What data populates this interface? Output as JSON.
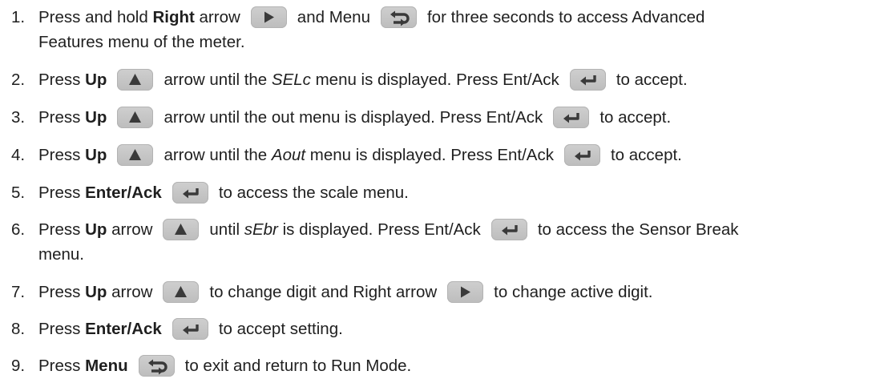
{
  "steps": [
    {
      "n": "1.",
      "parts": [
        [
          "Press and hold "
        ],
        [
          "Right",
          "b"
        ],
        [
          " arrow"
        ],
        [
          "K",
          "right"
        ],
        [
          "and Menu"
        ],
        [
          "K",
          "menu"
        ],
        [
          "for three seconds to access Advanced"
        ]
      ],
      "wrap": "Features menu of the meter."
    },
    {
      "n": "2.",
      "parts": [
        [
          "Press "
        ],
        [
          "Up",
          "b"
        ],
        [
          "K",
          "up"
        ],
        [
          "arrow until the "
        ],
        [
          "SELc",
          "i"
        ],
        [
          " menu is displayed. Press Ent/Ack"
        ],
        [
          "K",
          "enter"
        ],
        [
          "to accept."
        ]
      ]
    },
    {
      "n": "3.",
      "parts": [
        [
          "Press "
        ],
        [
          "Up",
          "b"
        ],
        [
          "K",
          "up"
        ],
        [
          "arrow until the out menu is displayed. Press Ent/Ack"
        ],
        [
          "K",
          "enter"
        ],
        [
          "to accept."
        ]
      ]
    },
    {
      "n": "4.",
      "parts": [
        [
          "Press "
        ],
        [
          "Up",
          "b"
        ],
        [
          "K",
          "up"
        ],
        [
          "arrow until the "
        ],
        [
          "Aout",
          "i"
        ],
        [
          " menu is displayed. Press Ent/Ack"
        ],
        [
          "K",
          "enter"
        ],
        [
          "to accept."
        ]
      ]
    },
    {
      "n": "5.",
      "parts": [
        [
          "Press "
        ],
        [
          "Enter/Ack",
          "b"
        ],
        [
          "K",
          "enter"
        ],
        [
          "to access the scale menu."
        ]
      ]
    },
    {
      "n": "6.",
      "parts": [
        [
          "Press "
        ],
        [
          "Up",
          "b"
        ],
        [
          " arrow"
        ],
        [
          "K",
          "up"
        ],
        [
          "until "
        ],
        [
          "sEbr",
          "i"
        ],
        [
          " is displayed. Press Ent/Ack"
        ],
        [
          "K",
          "enter"
        ],
        [
          "to access the Sensor Break"
        ]
      ],
      "wrap": "menu."
    },
    {
      "n": "7.",
      "parts": [
        [
          "Press "
        ],
        [
          "Up",
          "b"
        ],
        [
          " arrow"
        ],
        [
          "K",
          "up"
        ],
        [
          "to change digit and Right arrow"
        ],
        [
          "K",
          "right"
        ],
        [
          "to change active digit."
        ]
      ]
    },
    {
      "n": "8.",
      "parts": [
        [
          "Press "
        ],
        [
          "Enter/Ack",
          "b"
        ],
        [
          "K",
          "enter"
        ],
        [
          "to accept setting."
        ]
      ]
    },
    {
      "n": "9.",
      "parts": [
        [
          "Press "
        ],
        [
          "Menu",
          "b"
        ],
        [
          "K",
          "menu"
        ],
        [
          "to exit and return to Run Mode."
        ]
      ]
    }
  ],
  "icons": {
    "right": "right-arrow-key-icon",
    "menu": "menu-key-icon",
    "up": "up-arrow-key-icon",
    "enter": "enter-ack-key-icon"
  },
  "colors": {
    "text": "#1f1f1f",
    "key_bg": "#c8c8c8",
    "key_glyph": "#3a3a3a"
  }
}
